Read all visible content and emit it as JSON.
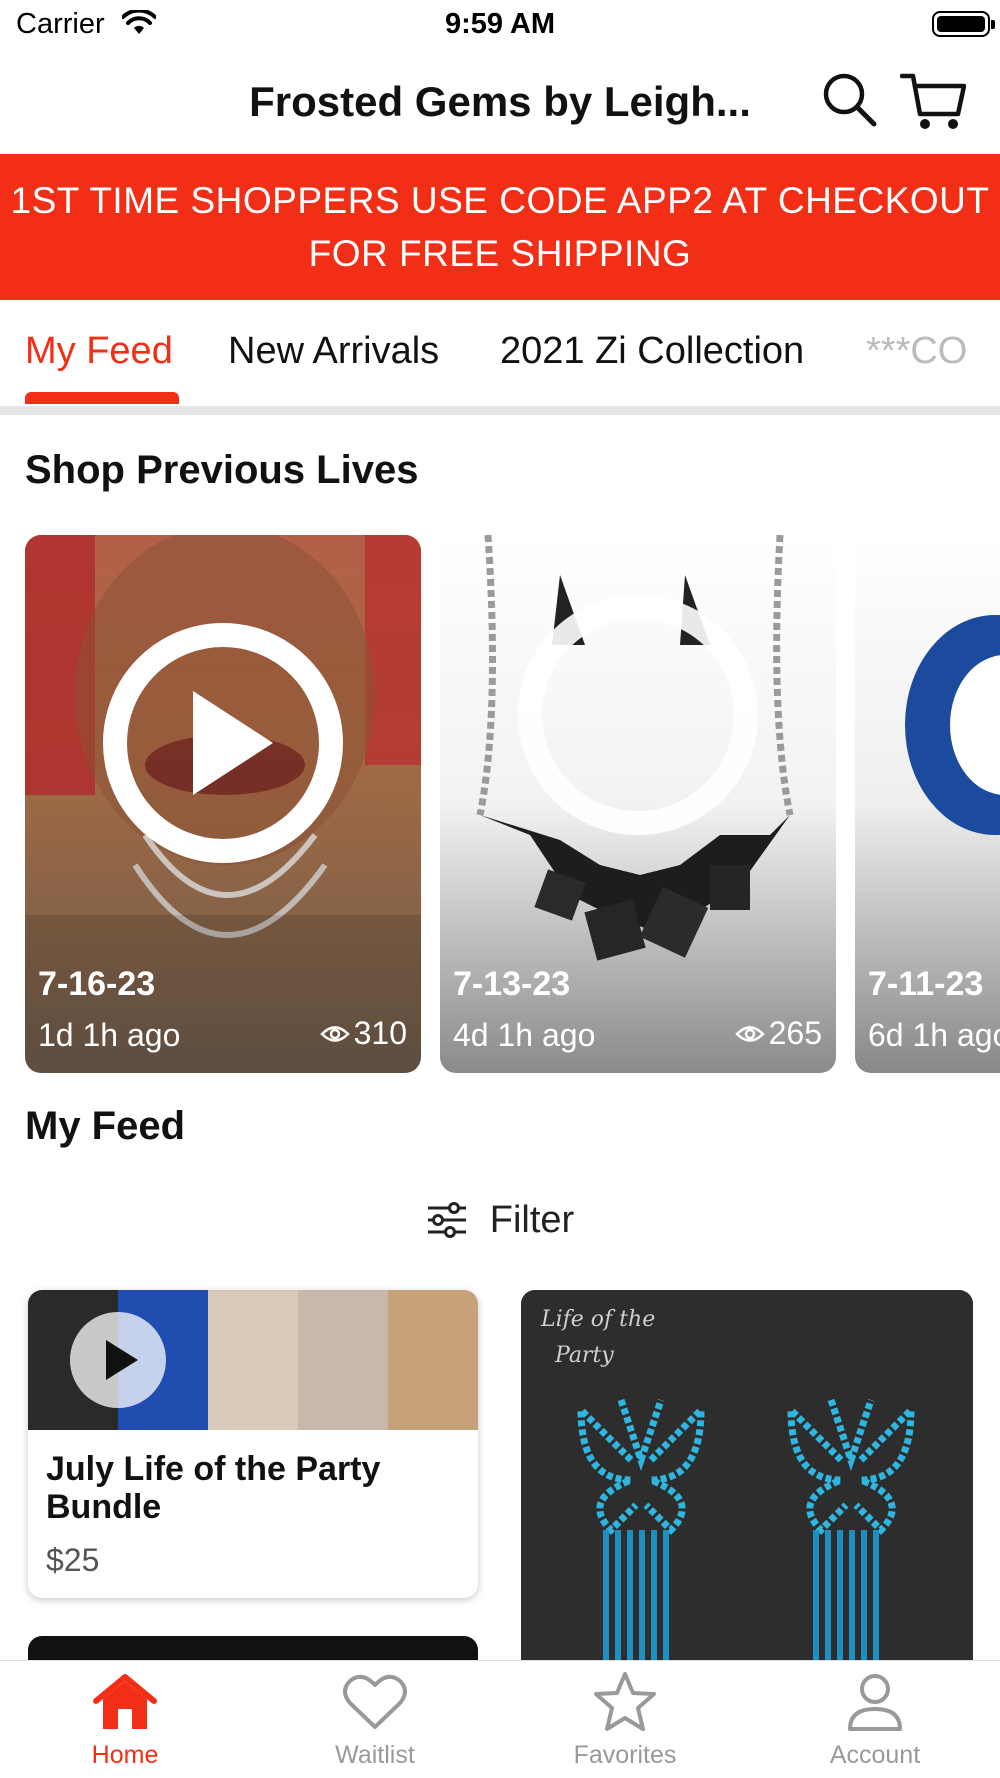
{
  "status_bar": {
    "carrier": "Carrier",
    "time": "9:59 AM"
  },
  "nav": {
    "title": "Frosted Gems by Leigh...",
    "search_icon": "search-icon",
    "cart_icon": "cart-icon"
  },
  "promo": {
    "line1": "1ST TIME SHOPPERS USE CODE APP2 AT CHECKOUT",
    "line2": "FOR FREE SHIPPING"
  },
  "tabs": [
    {
      "label": "My Feed",
      "active": true
    },
    {
      "label": "New Arrivals"
    },
    {
      "label": "2021 Zi Collection"
    },
    {
      "label": "***CO"
    }
  ],
  "shop_previous": {
    "title": "Shop Previous Lives",
    "lives": [
      {
        "date": "7-16-23",
        "ago": "1d 1h ago",
        "views": "310"
      },
      {
        "date": "7-13-23",
        "ago": "4d 1h ago",
        "views": "265"
      },
      {
        "date": "7-11-23",
        "ago": "6d 1h ago",
        "views": ""
      }
    ]
  },
  "feed": {
    "title": "My Feed",
    "filter_label": "Filter",
    "products": [
      {
        "name": "July Life of the Party Bundle",
        "price": "$25"
      }
    ],
    "earring_brand_line1": "Life of the",
    "earring_brand_line2": "Party"
  },
  "tab_bar": [
    {
      "label": "Home",
      "icon": "home-icon",
      "active": true
    },
    {
      "label": "Waitlist",
      "icon": "heart-icon"
    },
    {
      "label": "Favorites",
      "icon": "star-icon"
    },
    {
      "label": "Account",
      "icon": "person-icon"
    }
  ],
  "colors": {
    "accent": "#f22e16",
    "inactive": "#999999"
  }
}
